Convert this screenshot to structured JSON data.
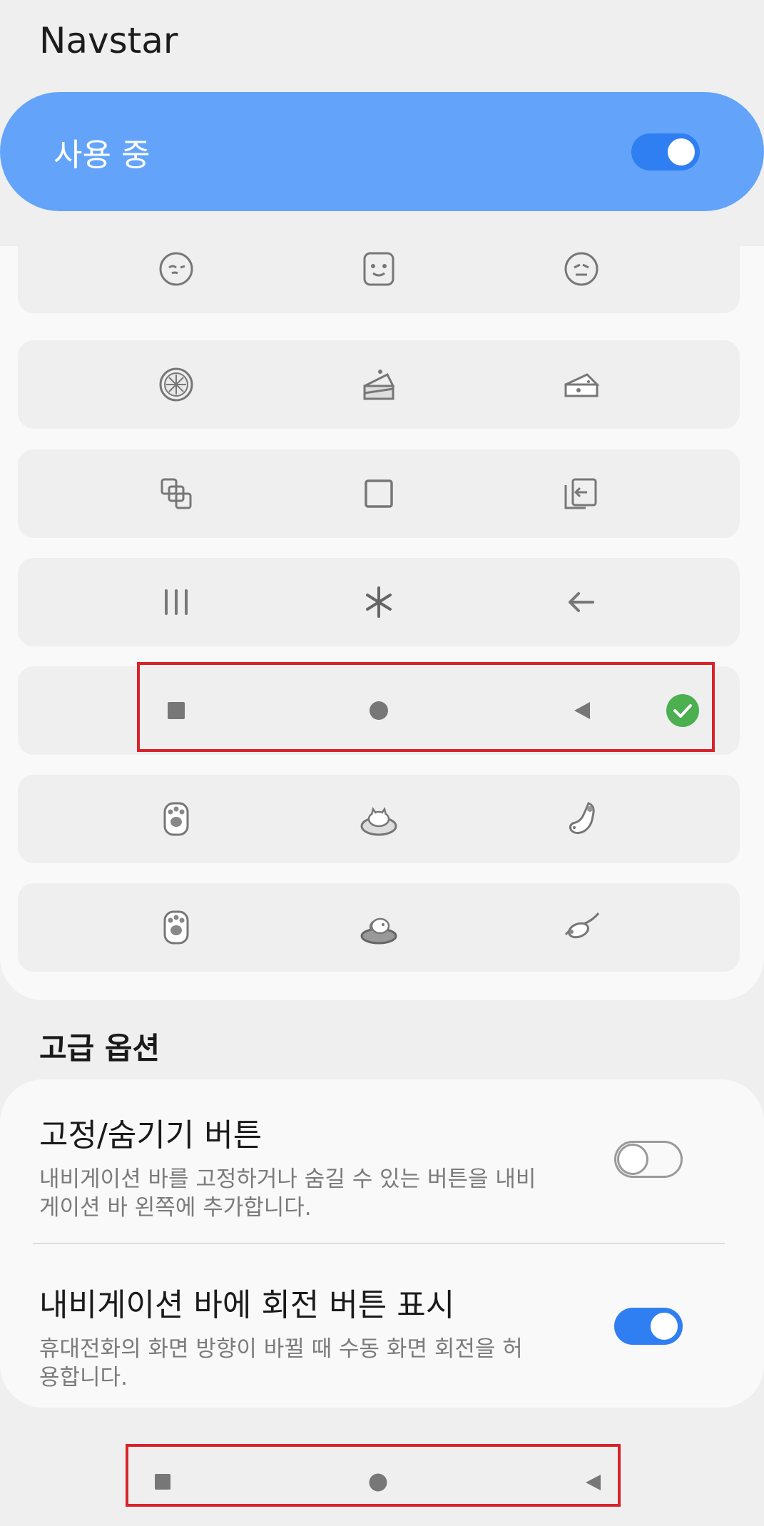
{
  "app": {
    "title": "Navstar"
  },
  "master": {
    "label": "사용 중",
    "enabled": true
  },
  "styles": {
    "rows": [
      {
        "icons": [
          "emoji-face-icon",
          "emoji-face-icon",
          "emoji-face-icon"
        ]
      },
      {
        "icons": [
          "pizza-icon",
          "cake-slice-icon",
          "cheese-icon"
        ]
      },
      {
        "icons": [
          "overlapping-squares-icon",
          "square-outline-icon",
          "back-box-icon"
        ]
      },
      {
        "icons": [
          "three-lines-icon",
          "asterisk-icon",
          "arrow-left-icon"
        ]
      },
      {
        "icons": [
          "square-filled-icon",
          "circle-filled-icon",
          "triangle-back-icon"
        ],
        "selected": true
      },
      {
        "icons": [
          "cat-paw-icon",
          "cat-bed-icon",
          "cat-hanging-icon"
        ]
      },
      {
        "icons": [
          "dog-paw-icon",
          "dog-bed-icon",
          "dog-flying-icon"
        ]
      }
    ]
  },
  "advanced": {
    "section_title": "고급 옵션",
    "options": [
      {
        "title": "고정/숨기기 버튼",
        "desc": "내비게이션 바를 고정하거나 숨길 수 있는 버튼을 내비게이션 바 왼쪽에 추가합니다.",
        "enabled": false
      },
      {
        "title": "내비게이션 바에 회전 버튼 표시",
        "desc": "휴대전화의 화면 방향이 바뀔 때 수동 화면 회전을 허용합니다.",
        "enabled": true
      }
    ]
  },
  "navbar": {
    "buttons": [
      "recents-button",
      "home-button",
      "back-button"
    ]
  },
  "colors": {
    "accent": "#2f7ff2",
    "card_blue": "#63a4fa",
    "check_green": "#4caf50",
    "highlight_red": "#d8232a"
  }
}
